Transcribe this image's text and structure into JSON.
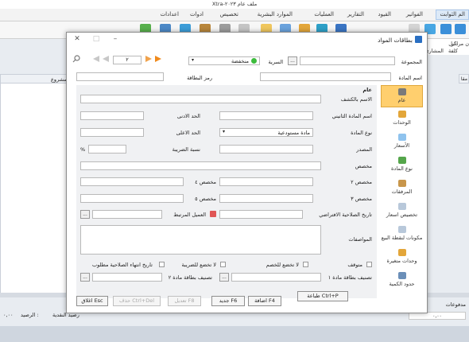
{
  "app": {
    "title": "Xtra-ملف عام ٢٠٢٣"
  },
  "menu": [
    {
      "label": "الم الثوابت"
    },
    {
      "label": "الفواتير"
    },
    {
      "label": "القيود"
    },
    {
      "label": "التقارير"
    },
    {
      "label": "العمليات"
    },
    {
      "label": "الموارد البشرية"
    },
    {
      "label": "تخصيص"
    },
    {
      "label": "ادوات"
    },
    {
      "label": "اعدادات"
    }
  ],
  "background": {
    "right_panel": {
      "line1": "دليل",
      "line2": "كلفة",
      "line3": "ن مراكز",
      "line4": "المشاري"
    },
    "table_header": "المشروع",
    "right_strip": "مقا",
    "footer": {
      "payments_label": "مدفوعات",
      "payments_value": "٠,٠٠",
      "cash_balance": "رصيد النقدية",
      "balance_label": "الرصيد :",
      "balance_value": "٠,٠٠"
    }
  },
  "dialog": {
    "title": "بطاقات المواد",
    "toolbar": {
      "group_label": "المجموعة",
      "secret_label": "السرية",
      "secret_value": "منخفضة",
      "page_value": "٢"
    },
    "item_name_label": "اسم المادة",
    "card_code_label": "رمز البطاقة",
    "section_title": "عام",
    "fields": {
      "name_in_statement": "الاسم بالكشف",
      "alt_name": "اسم المادة الثانيني",
      "min_limit": "الحد الادنى",
      "item_type": "نوع المادة",
      "item_type_value": "مادة مستودعية",
      "max_limit": "الحد الاعلى",
      "source": "المصدر",
      "tax_rate": "نسبة الضريبة",
      "percent": "%",
      "custom1": "مخصص",
      "custom2": "مخصص ٢",
      "custom4": "مخصص ٤",
      "custom3": "مخصص ٣",
      "custom5": "مخصص ٥",
      "expiry_default": "تاريخ الصلاحية الافتراضي",
      "linked_agent": "العميل المرتبط",
      "specifications": "المواصفات",
      "stopped": "متوقف",
      "no_discount": "لا تخضع للخصم",
      "no_tax": "لا تخضع للضريبة",
      "expiry_required": "تاريخ انتهاء الصلاحية مطلوب",
      "classify1": "تصنيف بطاقة مادة ١",
      "classify2": "تصنيف بطاقة مادة ٢"
    },
    "sidebar": [
      {
        "label": "عام"
      },
      {
        "label": "الوحدات"
      },
      {
        "label": "الأسعار"
      },
      {
        "label": "نوع المادة"
      },
      {
        "label": "المرفقات"
      },
      {
        "label": "تخصيص اسعار"
      },
      {
        "label": "مكونات لنقطة البيع"
      },
      {
        "label": "وحدات متغيرة"
      },
      {
        "label": "حدود الكمية"
      }
    ],
    "buttons": {
      "print": "طباعة Ctrl+P",
      "add": "اضافة F4",
      "new": "جديد F6",
      "edit": "تعديل F8",
      "delete": "حذف Ctrl+Del",
      "close": "اغلاق Esc"
    }
  }
}
